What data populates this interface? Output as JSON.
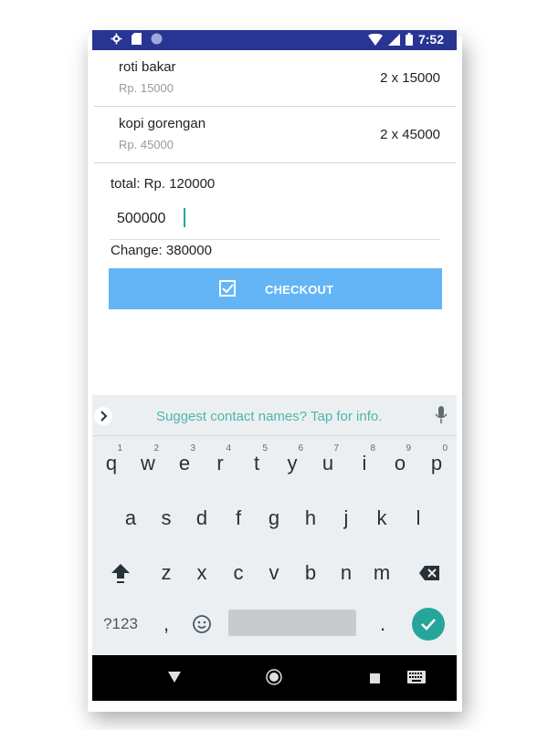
{
  "status_bar": {
    "time": "7:52",
    "left_icons": [
      "gear-icon",
      "sd-card-icon",
      "circle-icon"
    ],
    "right_icons": [
      "wifi-icon",
      "signal-icon",
      "battery-icon"
    ],
    "color": "#283593"
  },
  "cart": {
    "items": [
      {
        "name": "roti bakar",
        "price": "Rp. 15000",
        "qty": "2 x 15000"
      },
      {
        "name": "kopi gorengan",
        "price": "Rp. 45000",
        "qty": "2 x 45000"
      }
    ],
    "total": "total: Rp. 120000",
    "amount_value": "500000",
    "change": "Change: 380000",
    "checkout_label": "CHECKOUT",
    "checkout_color": "#64b5f6"
  },
  "keyboard": {
    "suggestion": "Suggest contact names? Tap for info.",
    "row1": [
      {
        "key": "q",
        "hint": "1"
      },
      {
        "key": "w",
        "hint": "2"
      },
      {
        "key": "e",
        "hint": "3"
      },
      {
        "key": "r",
        "hint": "4"
      },
      {
        "key": "t",
        "hint": "5"
      },
      {
        "key": "y",
        "hint": "6"
      },
      {
        "key": "u",
        "hint": "7"
      },
      {
        "key": "i",
        "hint": "8"
      },
      {
        "key": "o",
        "hint": "9"
      },
      {
        "key": "p",
        "hint": "0"
      }
    ],
    "row2": [
      "a",
      "s",
      "d",
      "f",
      "g",
      "h",
      "j",
      "k",
      "l"
    ],
    "row3": [
      "z",
      "x",
      "c",
      "v",
      "b",
      "n",
      "m"
    ],
    "symbols_label": "?123",
    "comma": ",",
    "period": ".",
    "accent": "#26a69a"
  },
  "nav_bar": {
    "icons": [
      "back-icon",
      "home-icon",
      "recents-icon",
      "keyboard-icon"
    ]
  }
}
